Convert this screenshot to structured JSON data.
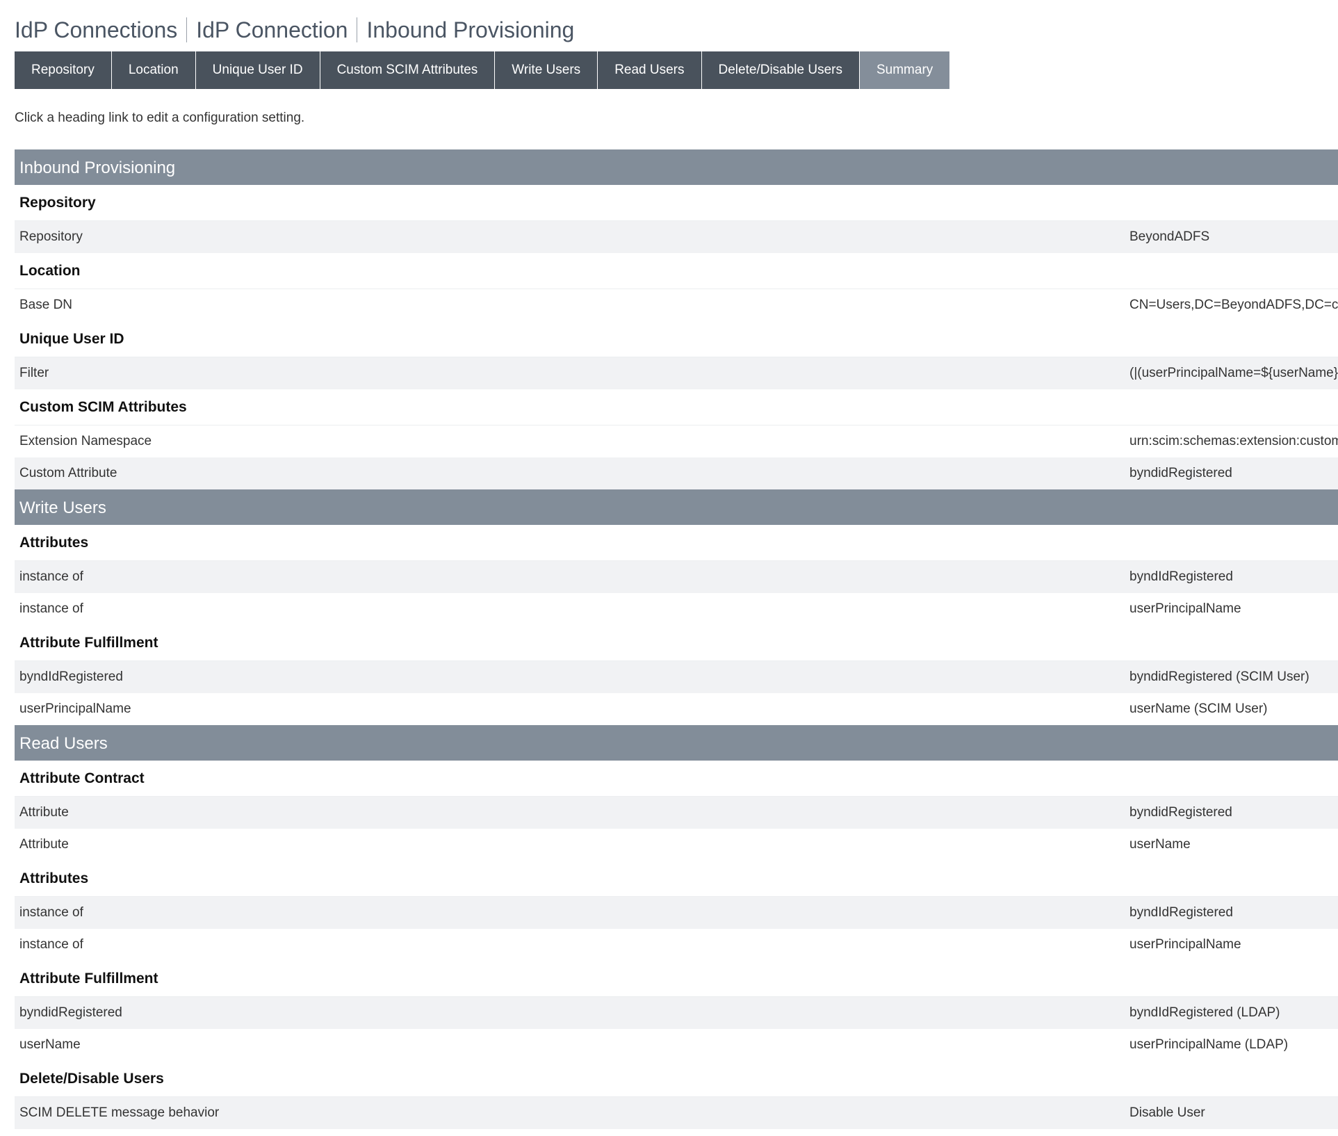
{
  "breadcrumb": [
    "IdP Connections",
    "IdP Connection",
    "Inbound Provisioning"
  ],
  "tabs": [
    "Repository",
    "Location",
    "Unique User ID",
    "Custom SCIM Attributes",
    "Write Users",
    "Read Users",
    "Delete/Disable Users",
    "Summary"
  ],
  "active_tab": "Summary",
  "intro": "Click a heading link to edit a configuration setting.",
  "sections": [
    {
      "title": "Inbound Provisioning",
      "groups": [
        {
          "heading": "Repository",
          "rows": [
            {
              "label": "Repository",
              "value": "BeyondADFS"
            }
          ]
        },
        {
          "heading": "Location",
          "rows": [
            {
              "label": "Base DN",
              "value": "CN=Users,DC=BeyondADFS,DC=co"
            }
          ]
        },
        {
          "heading": "Unique User ID",
          "rows": [
            {
              "label": "Filter",
              "value": "(|(userPrincipalName=${userName})("
            }
          ]
        },
        {
          "heading": "Custom SCIM Attributes",
          "rows": [
            {
              "label": "Extension Namespace",
              "value": "urn:scim:schemas:extension:custom"
            },
            {
              "label": "Custom Attribute",
              "value": "byndidRegistered"
            }
          ]
        }
      ]
    },
    {
      "title": "Write Users",
      "groups": [
        {
          "heading": "Attributes",
          "rows": [
            {
              "label": "instance of",
              "value": "byndIdRegistered"
            },
            {
              "label": "instance of",
              "value": "userPrincipalName"
            }
          ]
        },
        {
          "heading": "Attribute Fulfillment",
          "rows": [
            {
              "label": "byndIdRegistered",
              "value": "byndidRegistered (SCIM User)"
            },
            {
              "label": "userPrincipalName",
              "value": "userName (SCIM User)"
            }
          ]
        }
      ]
    },
    {
      "title": "Read Users",
      "groups": [
        {
          "heading": "Attribute Contract",
          "rows": [
            {
              "label": "Attribute",
              "value": "byndidRegistered"
            },
            {
              "label": "Attribute",
              "value": "userName"
            }
          ]
        },
        {
          "heading": "Attributes",
          "rows": [
            {
              "label": "instance of",
              "value": "byndIdRegistered"
            },
            {
              "label": "instance of",
              "value": "userPrincipalName"
            }
          ]
        },
        {
          "heading": "Attribute Fulfillment",
          "rows": [
            {
              "label": "byndidRegistered",
              "value": "byndIdRegistered (LDAP)"
            },
            {
              "label": "userName",
              "value": "userPrincipalName (LDAP)"
            }
          ]
        },
        {
          "heading": "Delete/Disable Users",
          "rows": [
            {
              "label": "SCIM DELETE message behavior",
              "value": "Disable User"
            }
          ]
        }
      ]
    }
  ]
}
